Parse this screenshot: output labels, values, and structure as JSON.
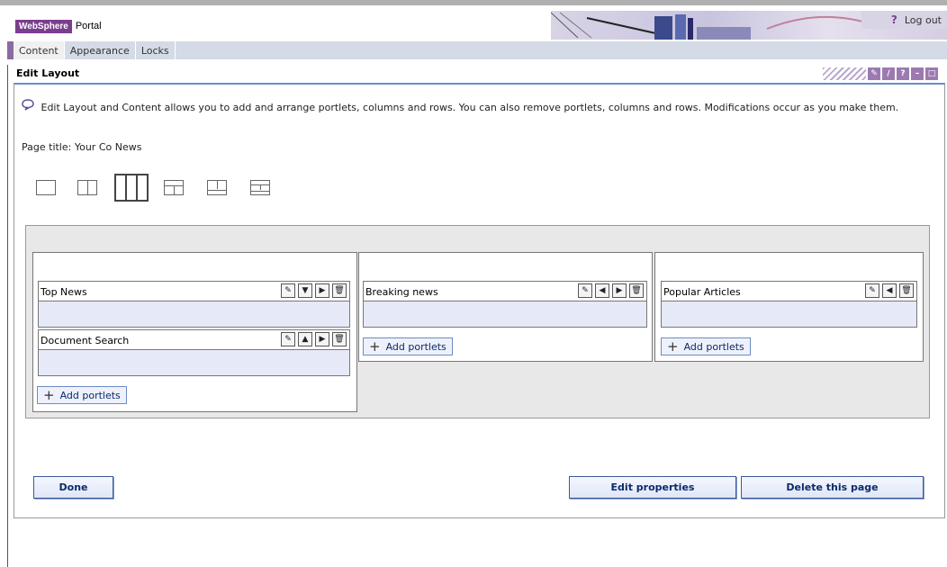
{
  "brand": {
    "product": "WebSphere",
    "name": "Portal"
  },
  "header": {
    "help_label": "?",
    "logout_label": "Log out"
  },
  "tabs": [
    {
      "label": "Content",
      "active": true
    },
    {
      "label": "Appearance",
      "active": false
    },
    {
      "label": "Locks",
      "active": false
    }
  ],
  "portlet_title": "Edit Layout",
  "title_controls": [
    "pencil-icon",
    "pen-icon",
    "help-icon",
    "minimize-icon",
    "maximize-icon"
  ],
  "description": "Edit Layout and Content allows you to add and arrange portlets, columns and rows. You can also remove portlets, columns and rows. Modifications occur as you make them.",
  "page_title_label": "Page title:",
  "page_title_value": "Your Co News",
  "layouts": [
    "one-column",
    "two-column",
    "three-column",
    "header-two-column",
    "two-column-footer",
    "header-two-column-footer"
  ],
  "selected_layout": "three-column",
  "columns": [
    {
      "portlets": [
        {
          "name": "Top News",
          "controls": [
            "edit-icon",
            "move-down-icon",
            "move-right-icon",
            "delete-icon"
          ]
        },
        {
          "name": "Document Search",
          "controls": [
            "edit-icon",
            "move-up-icon",
            "move-right-icon",
            "delete-icon"
          ]
        }
      ],
      "add_label": "Add portlets"
    },
    {
      "portlets": [
        {
          "name": "Breaking news",
          "controls": [
            "edit-icon",
            "move-left-icon",
            "move-right-icon",
            "delete-icon"
          ]
        }
      ],
      "add_label": "Add portlets"
    },
    {
      "portlets": [
        {
          "name": "Popular Articles",
          "controls": [
            "edit-icon",
            "move-left-icon",
            "delete-icon"
          ]
        }
      ],
      "add_label": "Add portlets"
    }
  ],
  "buttons": {
    "done": "Done",
    "edit_properties": "Edit properties",
    "delete_page": "Delete this page"
  }
}
